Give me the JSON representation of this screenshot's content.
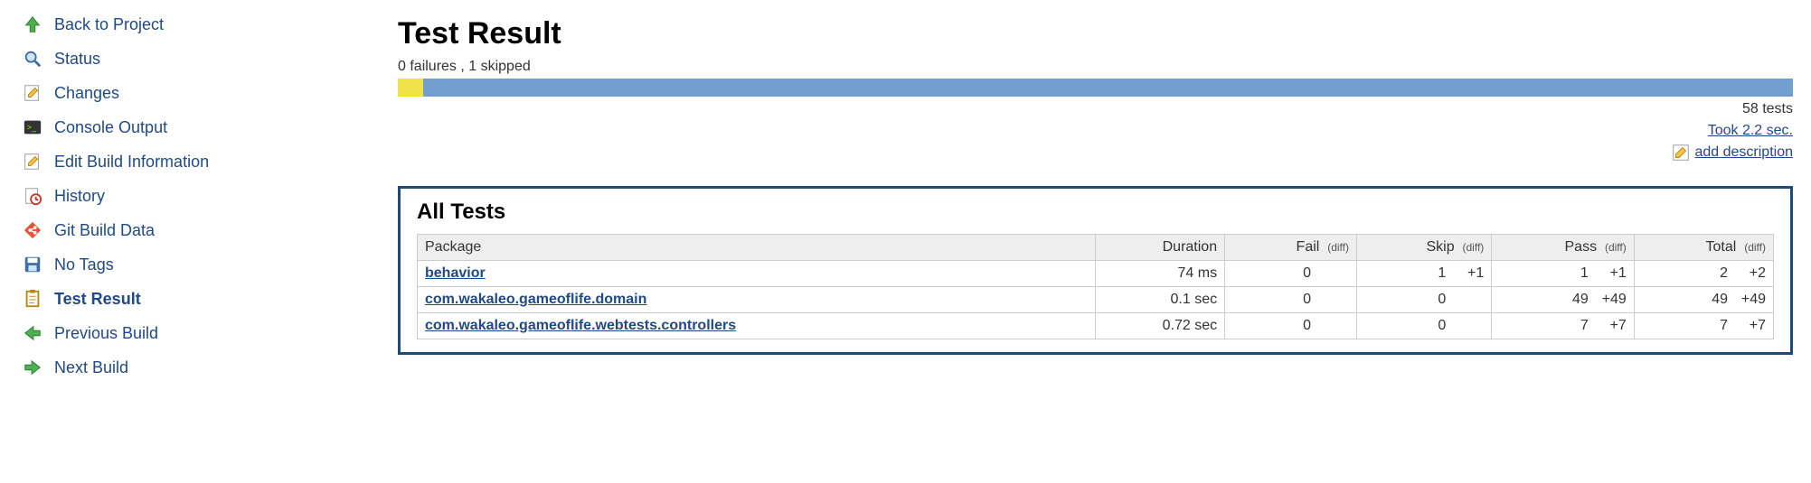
{
  "sidebar": {
    "items": [
      {
        "label": "Back to Project",
        "icon": "arrow-up-green"
      },
      {
        "label": "Status",
        "icon": "magnifier"
      },
      {
        "label": "Changes",
        "icon": "edit-page"
      },
      {
        "label": "Console Output",
        "icon": "terminal"
      },
      {
        "label": "Edit Build Information",
        "icon": "edit-page"
      },
      {
        "label": "History",
        "icon": "history"
      },
      {
        "label": "Git Build Data",
        "icon": "git"
      },
      {
        "label": "No Tags",
        "icon": "save"
      },
      {
        "label": "Test Result",
        "icon": "clipboard",
        "active": true
      },
      {
        "label": "Previous Build",
        "icon": "arrow-left-green"
      },
      {
        "label": "Next Build",
        "icon": "arrow-right-green"
      }
    ]
  },
  "header": {
    "title": "Test Result",
    "summary": "0 failures , 1 skipped",
    "total_tests_label": "58 tests",
    "took_label": "Took 2.2 sec.",
    "add_desc_label": "add description"
  },
  "bar": {
    "skip_pct": 1.8,
    "pass_pct": 98.2
  },
  "tests_section": {
    "heading": "All Tests",
    "columns": {
      "package": "Package",
      "duration": "Duration",
      "fail": "Fail",
      "skip": "Skip",
      "pass": "Pass",
      "total": "Total",
      "diff": "(diff)"
    },
    "rows": [
      {
        "pkg": "behavior",
        "duration": "74 ms",
        "fail": "0",
        "fail_d": "",
        "skip": "1",
        "skip_d": "+1",
        "pass": "1",
        "pass_d": "+1",
        "total": "2",
        "total_d": "+2"
      },
      {
        "pkg": "com.wakaleo.gameoflife.domain",
        "duration": "0.1 sec",
        "fail": "0",
        "fail_d": "",
        "skip": "0",
        "skip_d": "",
        "pass": "49",
        "pass_d": "+49",
        "total": "49",
        "total_d": "+49"
      },
      {
        "pkg": "com.wakaleo.gameoflife.webtests.controllers",
        "duration": "0.72 sec",
        "fail": "0",
        "fail_d": "",
        "skip": "0",
        "skip_d": "",
        "pass": "7",
        "pass_d": "+7",
        "total": "7",
        "total_d": "+7"
      }
    ]
  }
}
